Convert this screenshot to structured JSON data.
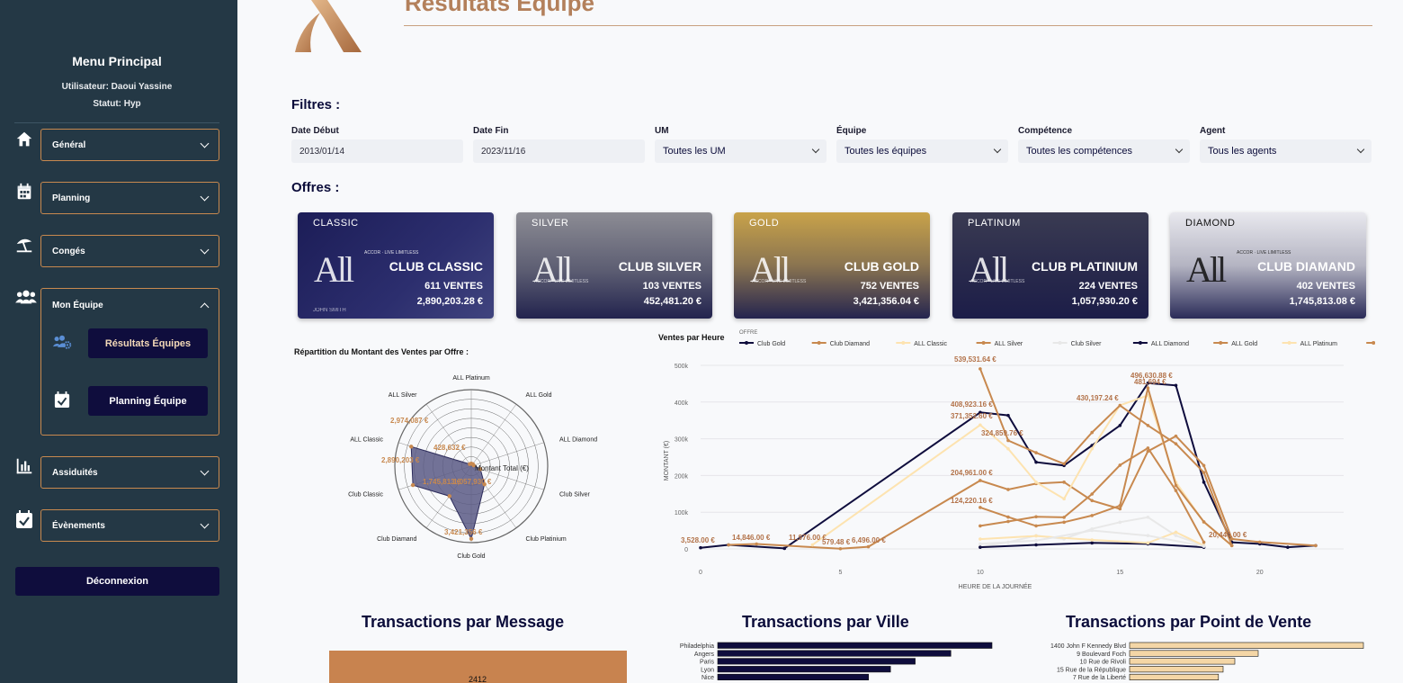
{
  "sidebar": {
    "title": "Menu Principal",
    "user": "Utilisateur: Daoui Yassine",
    "status": "Statut: Hyp",
    "items": [
      {
        "label": "Général",
        "icon": "home-icon"
      },
      {
        "label": "Planning",
        "icon": "calendar-icon"
      },
      {
        "label": "Congés",
        "icon": "beach-umbrella-icon"
      },
      {
        "label": "Mon Équipe",
        "icon": "users-icon"
      },
      {
        "label": "Assiduités",
        "icon": "bar-chart-icon"
      },
      {
        "label": "Évènements",
        "icon": "calendar-check-icon"
      }
    ],
    "sub_items": [
      {
        "label": "Résultats Équipes",
        "icon": "users-cog-icon"
      },
      {
        "label": "Planning Équipe",
        "icon": "calendar-check-icon"
      }
    ],
    "logout": "Déconnexion"
  },
  "header": {
    "title": "Résultats Équipe"
  },
  "filters": {
    "heading": "Filtres :",
    "start_label": "Date Début",
    "start_value": "2013/01/14",
    "end_label": "Date Fin",
    "end_value": "2023/11/16",
    "um_label": "UM",
    "um_value": "Toutes les UM",
    "team_label": "Équipe",
    "team_value": "Toutes les équipes",
    "skill_label": "Compétence",
    "skill_value": "Toutes les compétences",
    "agent_label": "Agent",
    "agent_value": "Tous les agents"
  },
  "offers": {
    "heading": "Offres :",
    "cards": [
      {
        "tier": "CLASSIC",
        "name": "CLUB CLASSIC",
        "sales": "611 VENTES",
        "amount": "2,890,203.28 €",
        "holder": "JOHN SMITH"
      },
      {
        "tier": "SILVER",
        "name": "CLUB SILVER",
        "sales": "103 VENTES",
        "amount": "452,481.20 €",
        "holder": ""
      },
      {
        "tier": "GOLD",
        "name": "CLUB GOLD",
        "sales": "752 VENTES",
        "amount": "3,421,356.04 €",
        "holder": ""
      },
      {
        "tier": "PLATINUM",
        "name": "CLUB PLATINIUM",
        "sales": "224 VENTES",
        "amount": "1,057,930.20 €",
        "holder": ""
      },
      {
        "tier": "DIAMOND",
        "name": "CLUB DIAMAND",
        "sales": "402 VENTES",
        "amount": "1,745,813.08 €",
        "holder": ""
      }
    ],
    "card_brand": "All",
    "card_tagline": "ACCOR · LIVE LIMITLESS"
  },
  "colors": {
    "accent": "#c8894f",
    "navy": "#0f0d3d",
    "sidebar": "#243845",
    "title": "#b3805b"
  },
  "chart_data": [
    {
      "type": "radar",
      "title": "Répartition du Montant des Ventes par Offre :",
      "categories": [
        "ALL Silver",
        "ALL Platinum",
        "ALL Gold",
        "ALL Diamond",
        "Club Silver",
        "Club Platinium",
        "Club Gold",
        "Club Diamand",
        "Club Classic",
        "ALL Classic"
      ],
      "series": [
        {
          "name": "Montant Total (€)",
          "values": [
            0,
            0,
            0,
            0,
            452481.2,
            1057930.2,
            3421356.04,
            1745813.08,
            2890203.28,
            2974087
          ]
        }
      ],
      "labels": [
        "2,974,087 €",
        "428,632 €",
        "2,890,203 €",
        "1,745,813 €",
        "1,057,930 €",
        "3,421,356 €"
      ]
    },
    {
      "type": "line",
      "title": "Ventes par Heure",
      "legend_title": "OFFRE",
      "xlabel": "HEURE DE LA JOURNÉE",
      "ylabel": "MONTANT (€)",
      "xlim": [
        0,
        23
      ],
      "ylim": [
        0,
        550000
      ],
      "xticks": [
        0,
        5,
        10,
        15,
        20
      ],
      "yticks": [
        "0",
        "100k",
        "200k",
        "300k",
        "400k",
        "500k"
      ],
      "series": [
        {
          "name": "Club Gold",
          "color": "#0f0d3d",
          "x": [
            0,
            1,
            3,
            10,
            11,
            12,
            13,
            14,
            15,
            16,
            17,
            18,
            19,
            20,
            21,
            22
          ],
          "y": [
            3528,
            12000,
            1500,
            408923,
            400000,
            260000,
            250000,
            310000,
            370000,
            496630,
            490000,
            200000,
            20000,
            15000,
            5000,
            10000
          ]
        },
        {
          "name": "Club Diamand",
          "color": "#c8894f",
          "x": [
            1,
            2,
            5,
            6,
            10,
            11,
            12,
            13,
            14,
            15,
            16,
            17,
            18,
            19,
            20,
            22
          ],
          "y": [
            12000,
            14846,
            579,
            6496,
            204961,
            178000,
            195863,
            200000,
            144846,
            120000,
            292508,
            338000,
            250000,
            30000,
            20440,
            10000
          ]
        },
        {
          "name": "ALL Classic",
          "color": "#fde3b0",
          "x": [
            4,
            10,
            11,
            12,
            13,
            14,
            15,
            16,
            17,
            18,
            19
          ],
          "y": [
            11976,
            371352,
            300000,
            200000,
            150000,
            300000,
            430197,
            460000,
            200000,
            80000,
            10000
          ]
        },
        {
          "name": "ALL Silver",
          "color": "#c8894f",
          "x": [
            10,
            11,
            12,
            13,
            14,
            15,
            16,
            17,
            18,
            19
          ],
          "y": [
            124220,
            95411,
            69000,
            80000,
            100000,
            129634,
            481694,
            190000,
            81049,
            10000
          ]
        },
        {
          "name": "Club Silver",
          "color": "#e8e8e8",
          "x": [
            10,
            11,
            12,
            13,
            14,
            15,
            16,
            17,
            18
          ],
          "y": [
            6259,
            20000,
            40000,
            30000,
            60000,
            80000,
            95000,
            40000,
            10000
          ]
        },
        {
          "name": "ALL Diamond",
          "color": "#0f0d3d",
          "x": [
            10,
            12,
            14,
            16,
            18
          ],
          "y": [
            5000,
            12000,
            18000,
            15000,
            5000
          ]
        },
        {
          "name": "ALL Gold",
          "color": "#c8894f",
          "x": [
            10,
            11,
            12,
            13,
            14,
            15,
            16,
            17,
            18,
            19
          ],
          "y": [
            539531,
            324859,
            288297,
            255000,
            348866,
            430000,
            370000,
            315000,
            228862,
            10000
          ]
        },
        {
          "name": "ALL Platinum",
          "color": "#fde3b0",
          "x": [
            10,
            12,
            14,
            16,
            17,
            18
          ],
          "y": [
            29518,
            38907,
            26888,
            18000,
            50000,
            10000
          ]
        },
        {
          "name": "Club Classic",
          "color": "#c8894f",
          "x": [
            10,
            11,
            12,
            13,
            14,
            15,
            16,
            17,
            18
          ],
          "y": [
            69000,
            82237,
            96300,
            94728,
            164492,
            250890,
            302256,
            175031,
            20000
          ]
        },
        {
          "name": "Club Platinium",
          "color": "#e8e8e8",
          "x": [
            10,
            12,
            14,
            16,
            18
          ],
          "y": [
            15000,
            25000,
            55152,
            40000,
            8000
          ]
        }
      ],
      "labels": [
        "539,531.64 €",
        "496,630.88 €",
        "481,694 €",
        "430,197.24 €",
        "408,923.16 €",
        "371,352.60 €",
        "324,859.76 €",
        "204,961.00 €",
        "124,220.16 €",
        "20,440.00 €",
        "3,528.00 €",
        "14,846.00 €",
        "11,976.00 €",
        "579.48 €",
        "6,496.00 €"
      ]
    },
    {
      "type": "bar",
      "title": "Transactions par Message",
      "values": [
        2412
      ],
      "labels": [
        "2412"
      ]
    },
    {
      "type": "bar",
      "orientation": "horizontal",
      "title": "Transactions par Ville",
      "categories": [
        "Philadelphia",
        "Angers",
        "Paris",
        "Lyon",
        "Nice"
      ],
      "values": [
        100,
        85,
        72,
        63,
        55
      ]
    },
    {
      "type": "bar",
      "orientation": "horizontal",
      "title": "Transactions par Point de Vente",
      "categories": [
        "1400 John F Kennedy Blvd",
        "9 Boulevard Foch",
        "10 Rue de Rivoli",
        "15 Rue de la République",
        "7 Rue de la Liberté"
      ],
      "values": [
        100,
        55,
        45,
        40,
        38
      ]
    }
  ]
}
